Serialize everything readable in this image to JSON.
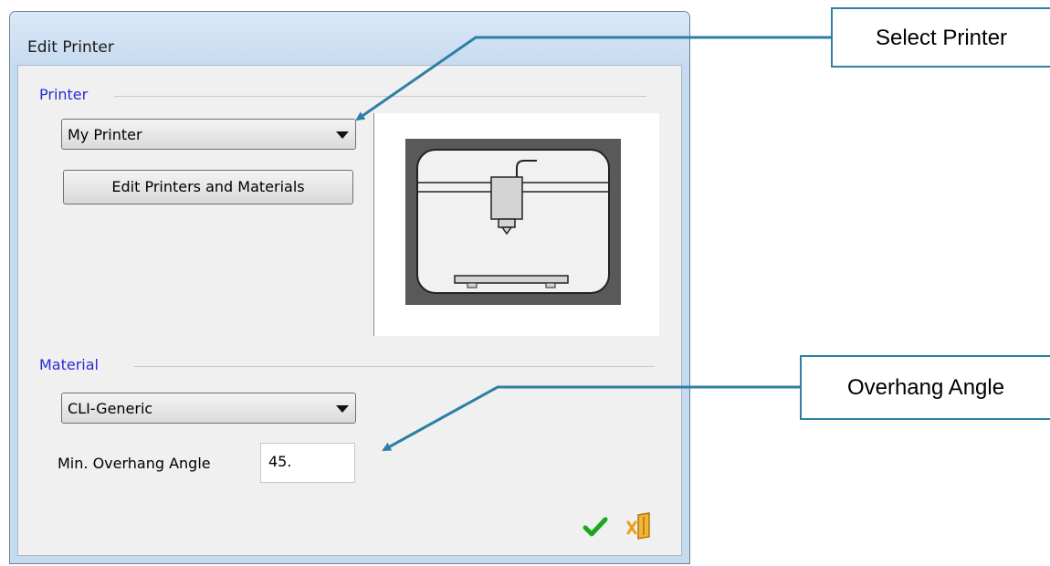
{
  "window": {
    "title": "Edit Printer"
  },
  "printer": {
    "group_label": "Printer",
    "selected": "My Printer",
    "edit_button_label": "Edit Printers and Materials"
  },
  "material": {
    "group_label": "Material",
    "selected": "CLI-Generic",
    "overhang_label": "Min. Overhang Angle",
    "overhang_value": "45."
  },
  "footer": {
    "ok_icon": "checkmark-icon",
    "cancel_icon": "exit-door-icon"
  },
  "callouts": {
    "select_printer": "Select Printer",
    "overhang_angle": "Overhang Angle"
  },
  "colors": {
    "group_label": "#2a2ad8",
    "callout_border": "#2d7fa6",
    "ok_green": "#19a81c",
    "cancel_orange": "#e8a21a"
  }
}
